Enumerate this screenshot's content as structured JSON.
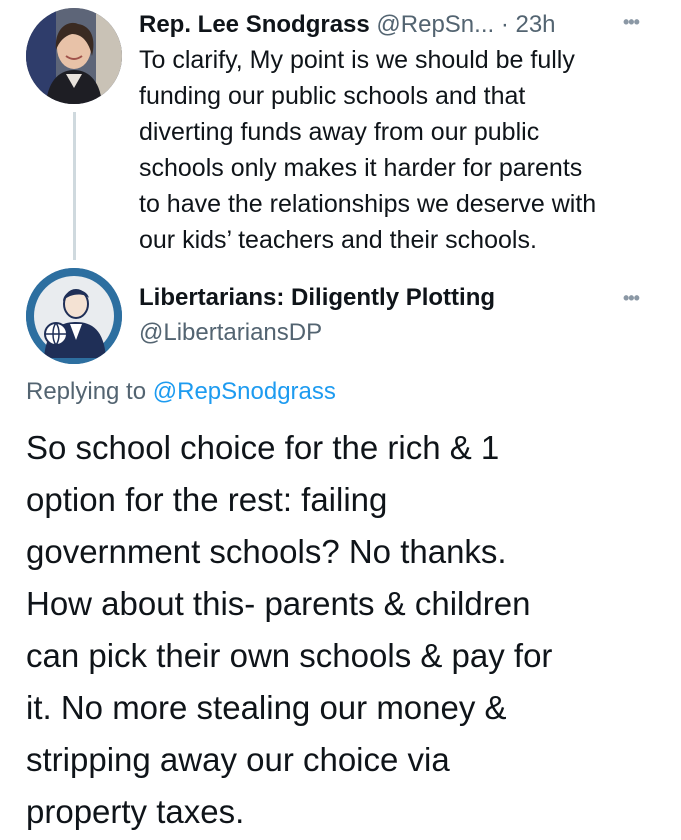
{
  "tweet1": {
    "display_name": "Rep. Lee Snodgrass",
    "handle": "@RepSn...",
    "time": "· 23h",
    "more_icon": "more-horizontal-icon",
    "avatar": "avatar-photo",
    "text": "To clarify, My point is we should be fully\nfunding our public schools and that\ndiverting funds away from our public\nschools only makes it harder for parents\nto have the relationships we deserve with\nour kids’ teachers and their schools."
  },
  "tweet2": {
    "display_name": "Libertarians: Diligently Plotting",
    "handle": "@LibertariansDP",
    "more_icon": "more-horizontal-icon",
    "avatar": "avatar-illustration",
    "replying_prefix": "Replying to",
    "replying_to": "@RepSnodgrass",
    "text": "So school choice for the rich & 1\noption for the rest: failing\ngovernment schools? No thanks.\nHow about this- parents & children\ncan pick their own schools & pay for\nit. No more stealing our money &\nstripping away our choice via\nproperty taxes."
  },
  "colors": {
    "text": "#0f1419",
    "muted": "#536471",
    "link": "#1d9bf0",
    "thread_line": "#cfd9de"
  }
}
